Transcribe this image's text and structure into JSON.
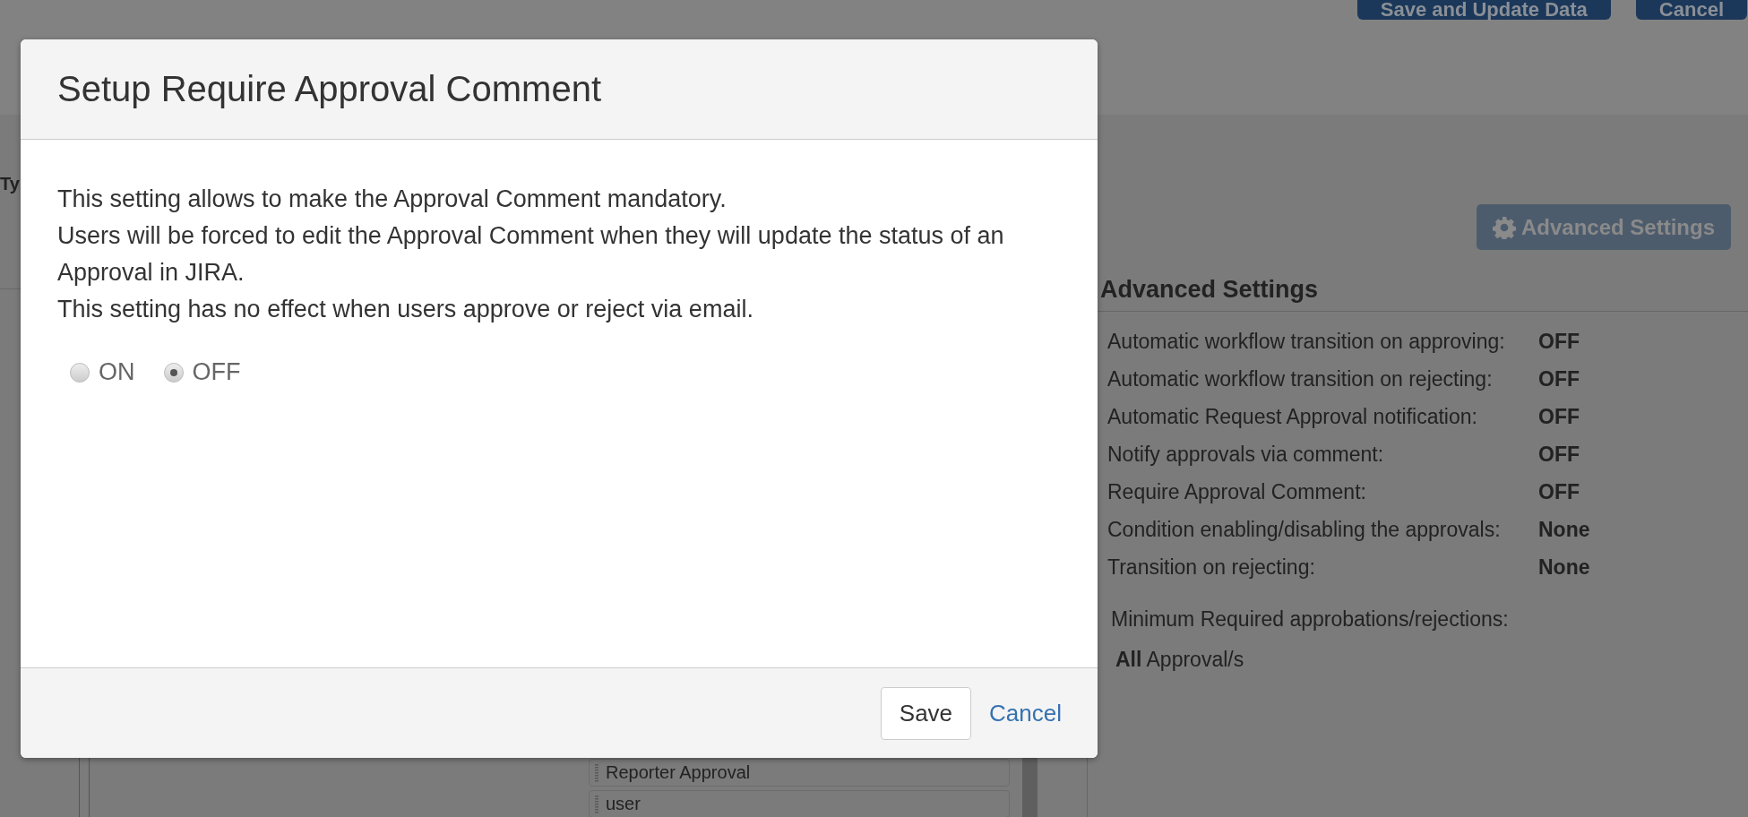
{
  "header_buttons": [
    {
      "label": "Save and Update Data"
    },
    {
      "label": "Cancel"
    }
  ],
  "page": {
    "side_label": "Ty",
    "advanced_settings_button": "Advanced Settings",
    "panel": {
      "title": "Advanced Settings",
      "settings": [
        {
          "label": "Automatic workflow transition on approving:",
          "value": "OFF"
        },
        {
          "label": "Automatic workflow transition on rejecting:",
          "value": "OFF"
        },
        {
          "label": "Automatic Request Approval notification:",
          "value": "OFF"
        },
        {
          "label": "Notify approvals via comment:",
          "value": "OFF"
        },
        {
          "label": "Require Approval Comment:",
          "value": "OFF"
        },
        {
          "label": "Condition enabling/disabling the approvals:",
          "value": "None"
        },
        {
          "label": "Transition on rejecting:",
          "value": "None"
        }
      ],
      "minimum_label": "Minimum Required approbations/rejections:",
      "minimum_value": "**All** Approval/s"
    },
    "list_items": [
      "Reporter Approval",
      "user"
    ]
  },
  "dialog": {
    "title": "Setup Require Approval Comment",
    "paragraphs": [
      "This setting allows to make the Approval Comment mandatory.",
      "Users will be forced to edit the Approval Comment when they will update the status of an Approval in JIRA.",
      "This setting has no effect when users approve or reject via email."
    ],
    "options": [
      {
        "label": "ON",
        "selected": false
      },
      {
        "label": "OFF",
        "selected": true
      }
    ],
    "buttons": [
      {
        "label": "Save",
        "kind": "button"
      },
      {
        "label": "Cancel",
        "kind": "link"
      }
    ]
  }
}
